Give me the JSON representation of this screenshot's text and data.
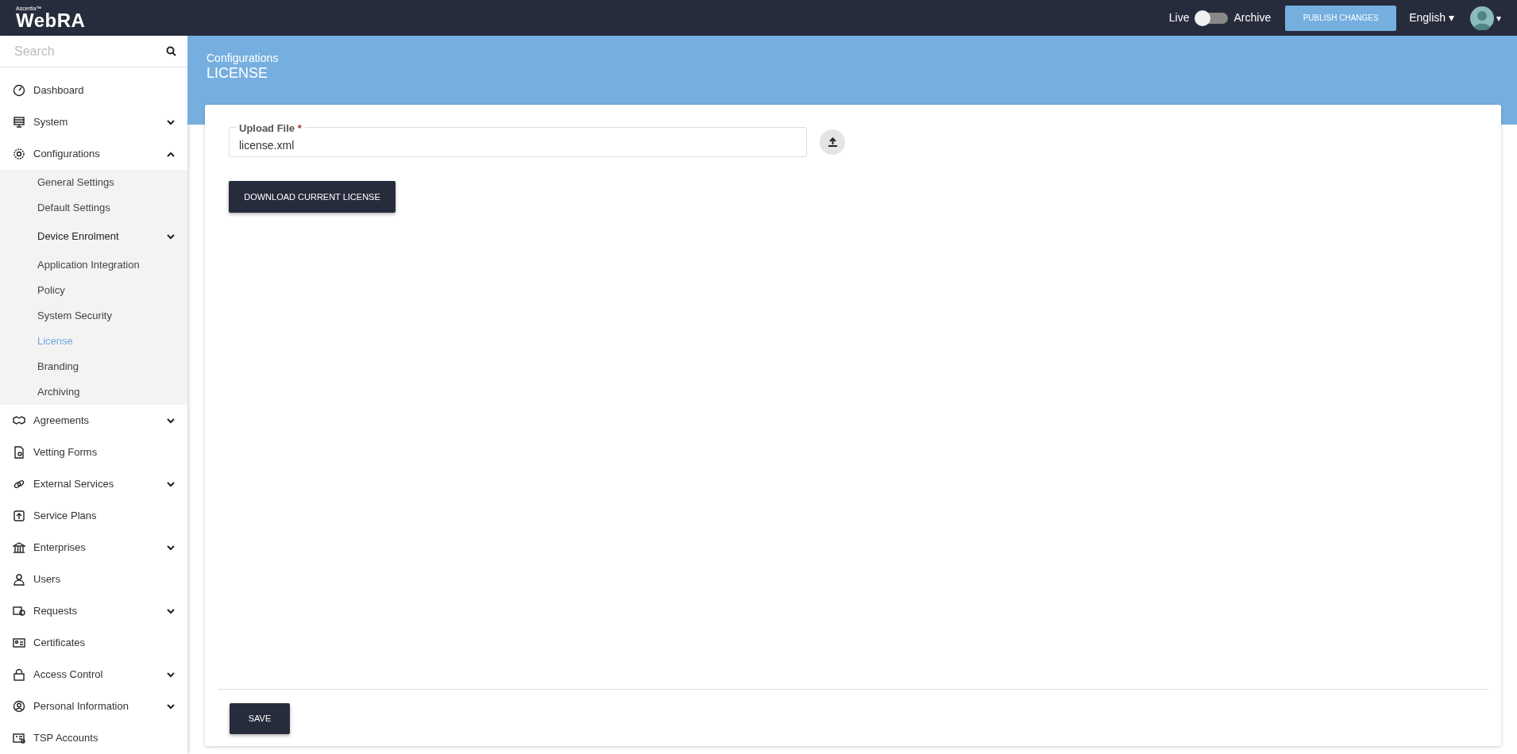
{
  "topbar": {
    "brand_small": "Ascertia™",
    "brand": "WebRA",
    "switch_left": "Live",
    "archive_switch": {
      "on": false
    },
    "switch_right": "Archive",
    "publish_button": "PUBLISH CHANGES",
    "language": "English ▾",
    "avatar_caret": "▾"
  },
  "sidebar": {
    "search": {
      "placeholder": "Search"
    },
    "items": [
      {
        "label": "Dashboard"
      },
      {
        "label": "System",
        "expanded": false
      },
      {
        "label": "Configurations",
        "expanded": true,
        "children": [
          {
            "label": "General Settings",
            "selected": false
          },
          {
            "label": "Default Settings",
            "selected": false
          },
          {
            "label": "Device Enrolment",
            "selected": false,
            "expanded": false
          },
          {
            "label": "Application Integration",
            "selected": false
          },
          {
            "label": "Policy",
            "selected": false
          },
          {
            "label": "System Security",
            "selected": false
          },
          {
            "label": "License",
            "selected": true
          },
          {
            "label": "Branding",
            "selected": false
          },
          {
            "label": "Archiving",
            "selected": false
          }
        ]
      },
      {
        "label": "Agreements",
        "expanded": false
      },
      {
        "label": "Vetting Forms"
      },
      {
        "label": "External Services",
        "expanded": false
      },
      {
        "label": "Service Plans"
      },
      {
        "label": "Enterprises",
        "expanded": false
      },
      {
        "label": "Users"
      },
      {
        "label": "Requests",
        "expanded": false
      },
      {
        "label": "Certificates"
      },
      {
        "label": "Access Control",
        "expanded": false
      },
      {
        "label": "Personal Information",
        "expanded": false
      },
      {
        "label": "TSP Accounts"
      }
    ]
  },
  "header": {
    "breadcrumb": "Configurations",
    "title": "LICENSE"
  },
  "form": {
    "upload_field": {
      "label": "Upload File",
      "required_mark": "*",
      "value": "license.xml"
    },
    "download_button": "DOWNLOAD CURRENT LICENSE",
    "save_button": "SAVE"
  }
}
